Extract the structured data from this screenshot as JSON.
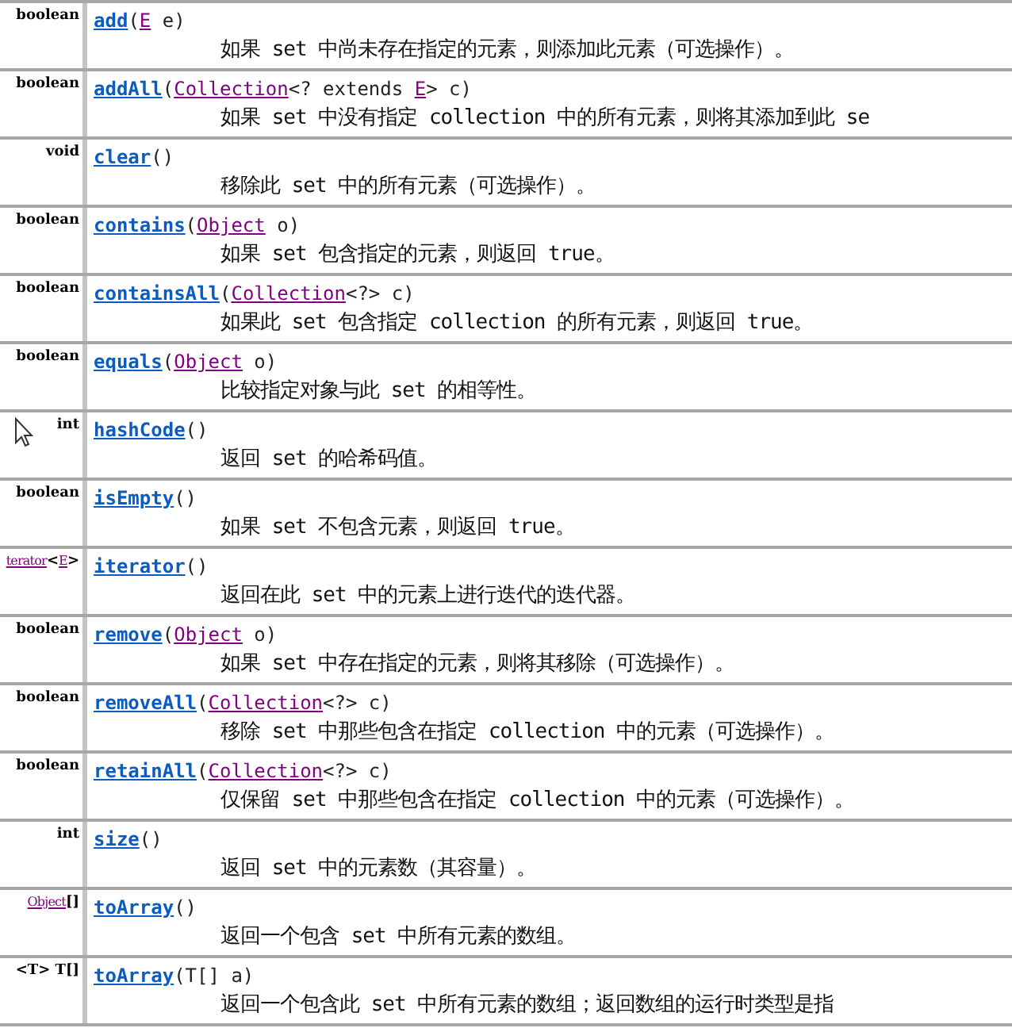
{
  "methods": [
    {
      "type": [
        {
          "text": "boolean",
          "kind": "plain"
        }
      ],
      "signature": [
        {
          "text": "add",
          "kind": "method"
        },
        {
          "text": "(",
          "kind": "plain"
        },
        {
          "text": "E",
          "kind": "type"
        },
        {
          "text": " e)",
          "kind": "plain"
        }
      ],
      "description": "如果 set 中尚未存在指定的元素，则添加此元素（可选操作）。"
    },
    {
      "type": [
        {
          "text": "boolean",
          "kind": "plain"
        }
      ],
      "signature": [
        {
          "text": "addAll",
          "kind": "method"
        },
        {
          "text": "(",
          "kind": "plain"
        },
        {
          "text": "Collection",
          "kind": "type"
        },
        {
          "text": "<? extends ",
          "kind": "plain"
        },
        {
          "text": "E",
          "kind": "type"
        },
        {
          "text": "> c)",
          "kind": "plain"
        }
      ],
      "description": "如果 set 中没有指定 collection 中的所有元素，则将其添加到此 se"
    },
    {
      "type": [
        {
          "text": "void",
          "kind": "plain"
        }
      ],
      "signature": [
        {
          "text": "clear",
          "kind": "method"
        },
        {
          "text": "()",
          "kind": "plain"
        }
      ],
      "description": "移除此 set 中的所有元素（可选操作）。"
    },
    {
      "type": [
        {
          "text": "boolean",
          "kind": "plain"
        }
      ],
      "signature": [
        {
          "text": "contains",
          "kind": "method"
        },
        {
          "text": "(",
          "kind": "plain"
        },
        {
          "text": "Object",
          "kind": "type"
        },
        {
          "text": " o)",
          "kind": "plain"
        }
      ],
      "description": "如果 set 包含指定的元素，则返回 true。"
    },
    {
      "type": [
        {
          "text": "boolean",
          "kind": "plain"
        }
      ],
      "signature": [
        {
          "text": "containsAll",
          "kind": "method"
        },
        {
          "text": "(",
          "kind": "plain"
        },
        {
          "text": "Collection",
          "kind": "type"
        },
        {
          "text": "<?> c)",
          "kind": "plain"
        }
      ],
      "description": "如果此 set 包含指定 collection 的所有元素，则返回 true。"
    },
    {
      "type": [
        {
          "text": "boolean",
          "kind": "plain"
        }
      ],
      "signature": [
        {
          "text": "equals",
          "kind": "method"
        },
        {
          "text": "(",
          "kind": "plain"
        },
        {
          "text": "Object",
          "kind": "type"
        },
        {
          "text": " o)",
          "kind": "plain"
        }
      ],
      "description": "比较指定对象与此 set 的相等性。"
    },
    {
      "type": [
        {
          "text": "int",
          "kind": "plain"
        }
      ],
      "cursor": true,
      "signature": [
        {
          "text": "hashCode",
          "kind": "method"
        },
        {
          "text": "()",
          "kind": "plain"
        }
      ],
      "description": "返回 set 的哈希码值。"
    },
    {
      "type": [
        {
          "text": "boolean",
          "kind": "plain"
        }
      ],
      "signature": [
        {
          "text": "isEmpty",
          "kind": "method"
        },
        {
          "text": "()",
          "kind": "plain"
        }
      ],
      "description": "如果 set 不包含元素，则返回 true。"
    },
    {
      "type": [
        {
          "text": "terator",
          "kind": "type"
        },
        {
          "text": "<",
          "kind": "plain"
        },
        {
          "text": "E",
          "kind": "type"
        },
        {
          "text": ">",
          "kind": "plain"
        }
      ],
      "signature": [
        {
          "text": "iterator",
          "kind": "method"
        },
        {
          "text": "()",
          "kind": "plain"
        }
      ],
      "description": "返回在此 set 中的元素上进行迭代的迭代器。"
    },
    {
      "type": [
        {
          "text": "boolean",
          "kind": "plain"
        }
      ],
      "signature": [
        {
          "text": "remove",
          "kind": "method"
        },
        {
          "text": "(",
          "kind": "plain"
        },
        {
          "text": "Object",
          "kind": "type"
        },
        {
          "text": " o)",
          "kind": "plain"
        }
      ],
      "description": "如果 set 中存在指定的元素，则将其移除（可选操作）。"
    },
    {
      "type": [
        {
          "text": "boolean",
          "kind": "plain"
        }
      ],
      "signature": [
        {
          "text": "removeAll",
          "kind": "method"
        },
        {
          "text": "(",
          "kind": "plain"
        },
        {
          "text": "Collection",
          "kind": "type"
        },
        {
          "text": "<?> c)",
          "kind": "plain"
        }
      ],
      "description": "移除 set 中那些包含在指定 collection 中的元素（可选操作）。"
    },
    {
      "type": [
        {
          "text": "boolean",
          "kind": "plain"
        }
      ],
      "signature": [
        {
          "text": "retainAll",
          "kind": "method"
        },
        {
          "text": "(",
          "kind": "plain"
        },
        {
          "text": "Collection",
          "kind": "type"
        },
        {
          "text": "<?> c)",
          "kind": "plain"
        }
      ],
      "description": "仅保留 set 中那些包含在指定 collection 中的元素（可选操作）。"
    },
    {
      "type": [
        {
          "text": "int",
          "kind": "plain"
        }
      ],
      "signature": [
        {
          "text": "size",
          "kind": "method"
        },
        {
          "text": "()",
          "kind": "plain"
        }
      ],
      "description": "返回 set 中的元素数（其容量）。"
    },
    {
      "type": [
        {
          "text": "Object",
          "kind": "type"
        },
        {
          "text": "[]",
          "kind": "plain"
        }
      ],
      "signature": [
        {
          "text": "toArray",
          "kind": "method"
        },
        {
          "text": "()",
          "kind": "plain"
        }
      ],
      "description": "返回一个包含 set 中所有元素的数组。"
    },
    {
      "type": [
        {
          "text": "<T> T[]",
          "kind": "plain"
        }
      ],
      "signature": [
        {
          "text": "toArray",
          "kind": "method"
        },
        {
          "text": "(T[] a)",
          "kind": "plain"
        }
      ],
      "description": "返回一个包含此 set 中所有元素的数组；返回数组的运行时类型是指"
    }
  ]
}
